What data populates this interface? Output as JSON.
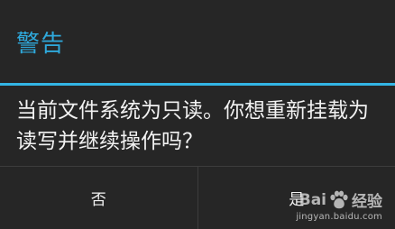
{
  "dialog": {
    "title": "警告",
    "message": "当前文件系统为只读。你想重新挂载为读写并继续操作吗？",
    "buttons": {
      "negative": "否",
      "positive": "是"
    }
  },
  "watermark": {
    "brand_left": "Bai",
    "brand_right": "经验",
    "url": "jingyan.baidu.com",
    "icon": "paw-icon"
  },
  "colors": {
    "accent": "#33b5e5",
    "title": "#2fa9dc",
    "background": "#262626",
    "text": "#f2f2f2"
  }
}
